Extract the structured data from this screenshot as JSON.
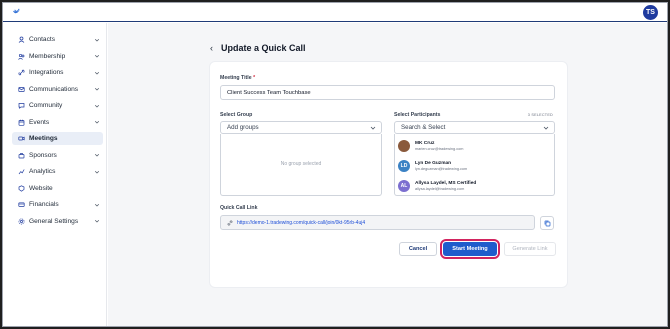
{
  "topbar": {
    "user_initials": "TS"
  },
  "sidebar": {
    "items": [
      {
        "label": "Contacts",
        "icon": "contacts-icon",
        "chevron": true
      },
      {
        "label": "Membership",
        "icon": "membership-icon",
        "chevron": true
      },
      {
        "label": "Integrations",
        "icon": "integrations-icon",
        "chevron": true
      },
      {
        "label": "Communications",
        "icon": "communications-icon",
        "chevron": true
      },
      {
        "label": "Community",
        "icon": "community-icon",
        "chevron": true
      },
      {
        "label": "Events",
        "icon": "events-icon",
        "chevron": true
      },
      {
        "label": "Meetings",
        "icon": "meetings-icon",
        "chevron": false,
        "active": true
      },
      {
        "label": "Sponsors",
        "icon": "sponsors-icon",
        "chevron": true
      },
      {
        "label": "Analytics",
        "icon": "analytics-icon",
        "chevron": true
      },
      {
        "label": "Website",
        "icon": "website-icon",
        "chevron": false
      },
      {
        "label": "Financials",
        "icon": "financials-icon",
        "chevron": true
      },
      {
        "label": "General Settings",
        "icon": "settings-icon",
        "chevron": true
      }
    ]
  },
  "page": {
    "title": "Update a Quick Call"
  },
  "form": {
    "meeting_title_label": "Meeting Title",
    "required_mark": "*",
    "meeting_title_value": "Client Success Team Touchbase",
    "select_group_label": "Select Group",
    "group_placeholder": "Add groups",
    "no_group_text": "No group selected",
    "select_participants_label": "Select Participants",
    "selected_count": "3 SELECTED",
    "participants_placeholder": "Search & Select",
    "participants": [
      {
        "name": "MK Cruz",
        "email": "marien.cruz@tradewing.com",
        "initials": "",
        "color": "#8a5a3c"
      },
      {
        "name": "Lyn De Guzman",
        "email": "lyn.deguzman@tradewing.com",
        "initials": "LD",
        "color": "#3b82c4"
      },
      {
        "name": "Allysa Laydel, MS Certified",
        "email": "allysa.laydel@tradewing.com",
        "initials": "AL",
        "color": "#7c6fd0"
      }
    ],
    "quick_call_link_label": "Quick Call Link",
    "quick_call_link": "https://demo-1.tradewing.com/quick-call/join/0kt-95rb-4uj4"
  },
  "actions": {
    "cancel": "Cancel",
    "start": "Start Meeting",
    "generate": "Generate Link"
  },
  "colors": {
    "accent": "#1f5ccc",
    "highlight": "#d2245f",
    "brand": "#1f3b78"
  }
}
